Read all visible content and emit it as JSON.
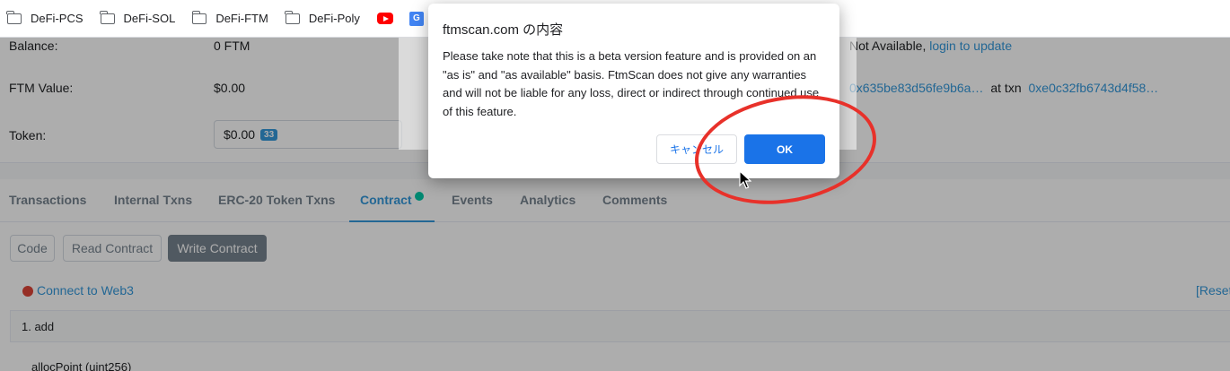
{
  "bookmarks": [
    {
      "label": "DeFi-PCS"
    },
    {
      "label": "DeFi-SOL"
    },
    {
      "label": "DeFi-FTM"
    },
    {
      "label": "DeFi-Poly"
    }
  ],
  "overview": {
    "balance_label": "Balance:",
    "balance_value": "0 FTM",
    "value_label": "FTM Value:",
    "value_value": "$0.00",
    "token_label": "Token:",
    "token_value": "$0.00",
    "token_count": "33",
    "name_tag_text": "Not Available,",
    "name_tag_link": "login to update",
    "creator_address": "0x635be83d56fe9b6a…",
    "creator_at": "at txn",
    "creator_txn": "0xe0c32fb6743d4f58…"
  },
  "tabs": [
    {
      "label": "Transactions"
    },
    {
      "label": "Internal Txns"
    },
    {
      "label": "ERC-20 Token Txns"
    },
    {
      "label": "Contract"
    },
    {
      "label": "Events"
    },
    {
      "label": "Analytics"
    },
    {
      "label": "Comments"
    }
  ],
  "contract": {
    "buttons": [
      "Code",
      "Read Contract",
      "Write Contract"
    ],
    "connect_label": "Connect to Web3",
    "reset_label": "[Reset",
    "function_title": "1. add",
    "param_label": "allocPoint (uint256)"
  },
  "dialog": {
    "title": "ftmscan.com の内容",
    "message": "Please take note that this is a beta version feature and is provided on an \"as is\" and \"as available\" basis. FtmScan does not give any warranties and will not be liable for any loss, direct or indirect through continued use of this feature.",
    "cancel_label": "キャンセル",
    "ok_label": "OK"
  },
  "colors": {
    "accent": "#1a73e8",
    "annotation": "#e8312a"
  }
}
